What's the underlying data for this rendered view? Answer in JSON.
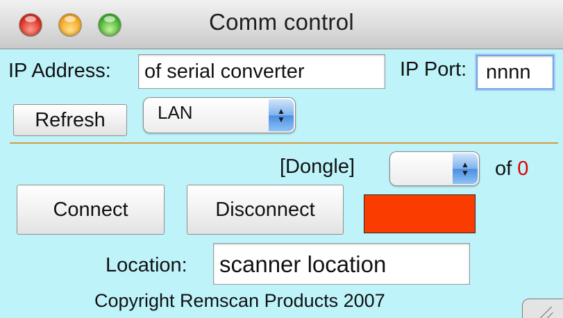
{
  "window": {
    "title": "Comm control"
  },
  "ip": {
    "label": "IP Address:",
    "value": "of serial converter"
  },
  "port": {
    "label": "IP Port:",
    "value": "nnnn"
  },
  "refresh": {
    "label": "Refresh"
  },
  "connection_type": {
    "selected": "LAN"
  },
  "dongle": {
    "label": "[Dongle]",
    "selected": "",
    "of_label": "of",
    "count": "0",
    "count_color": "#e00000"
  },
  "connect": {
    "label": "Connect"
  },
  "disconnect": {
    "label": "Disconnect"
  },
  "status_indicator": {
    "color": "#fa3c00"
  },
  "location": {
    "label": "Location:",
    "value": "scanner location"
  },
  "footer": {
    "copyright": "Copyright Remscan Products 2007"
  },
  "colors": {
    "background": "#bdf3f9",
    "divider": "#d59a3c",
    "focus_ring": "#6fa7e6"
  }
}
